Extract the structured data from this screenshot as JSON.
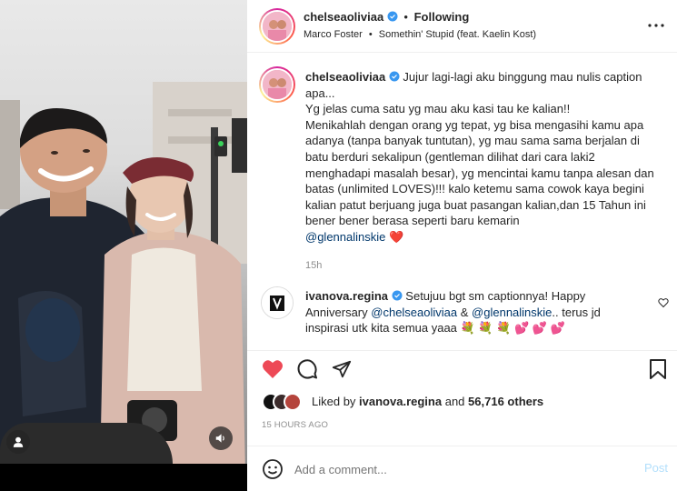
{
  "post": {
    "author": "chelseaoliviaa",
    "following_label": "Following",
    "music_artist": "Marco Foster",
    "music_track": "Somethin' Stupid (feat. Kaelin Kost)",
    "more_icon": "more-horizontal-icon"
  },
  "caption": {
    "author": "chelseaoliviaa",
    "lines": [
      "Jujur lagi-lagi aku binggung mau nulis caption apa...",
      "Yg jelas cuma satu yg mau aku kasi tau ke kalian!!",
      "Menikahlah dengan orang yg tepat, yg bisa mengasihi kamu apa adanya (tanpa banyak tuntutan), yg mau sama sama berjalan di batu berduri sekalipun (gentleman dilihat dari cara laki2 menghadapi masalah besar), yg mencintai kamu tanpa alesan dan batas (unlimited LOVES)!!! kalo ketemu sama cowok kaya begini kalian patut berjuang juga buat pasangan kalian,dan 15 Tahun ini bener bener berasa seperti baru kemarin"
    ],
    "mention": "@glennalinskie",
    "emoji": "❤️",
    "time": "15h"
  },
  "comment": {
    "author": "ivanova.regina",
    "text_before": "Setujuu bgt sm captionnya! Happy Anniversary",
    "mention1": "@chelseaoliviaa",
    "amp": "&",
    "mention2": "@glennalinskie",
    "text_after": ".. terus jd inspirasi utk kita semua yaaa",
    "emojis": "💐 💐 💐 💕 💕 💕"
  },
  "likes": {
    "liked_by_prefix": "Liked by",
    "liked_by_user": "ivanova.regina",
    "and_label": "and",
    "others_label": "56,716 others",
    "timestamp": "15 HOURS AGO"
  },
  "composer": {
    "placeholder": "Add a comment...",
    "post_label": "Post"
  },
  "colors": {
    "like_red": "#ed4956",
    "link_blue": "#00376b",
    "verified_blue": "#3897f0",
    "post_button": "#b2dffc",
    "muted": "#8e8e8e"
  }
}
